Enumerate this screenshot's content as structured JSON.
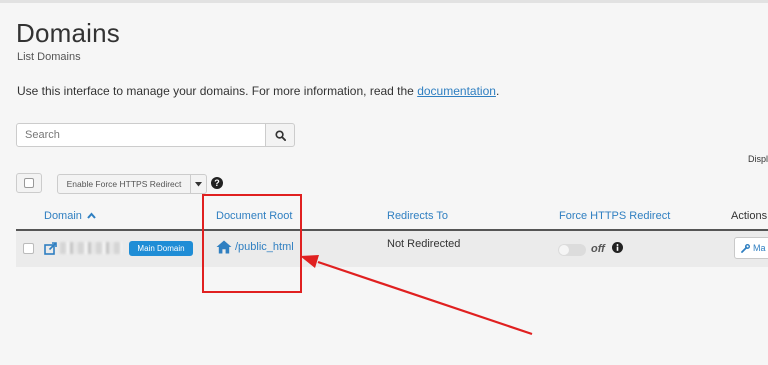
{
  "page": {
    "title": "Domains",
    "subtitle": "List Domains",
    "intro_text": "Use this interface to manage your domains. For more information, read the ",
    "intro_link": "documentation",
    "intro_end": "."
  },
  "search": {
    "placeholder": "Search",
    "button_icon": "search-icon"
  },
  "display_label": "Displ",
  "toolbar": {
    "https_button_label": "Enable Force HTTPS Redirect",
    "caret_icon": "caret-down-icon",
    "help_icon": "question-circle-icon"
  },
  "table": {
    "columns": [
      "Domain",
      "Document Root",
      "Redirects To",
      "Force HTTPS Redirect",
      "Actions"
    ],
    "sort_icon": "chevron-up-icon",
    "rows": [
      {
        "domain_badge": "Main Domain",
        "document_root": "/public_html",
        "redirects_to": "Not Redirected",
        "force_https_toggle": "off",
        "action_label": "Ma"
      }
    ]
  },
  "colors": {
    "link": "#2f7fc1",
    "badge": "#1f8dd6",
    "annotation": "#e02020"
  }
}
